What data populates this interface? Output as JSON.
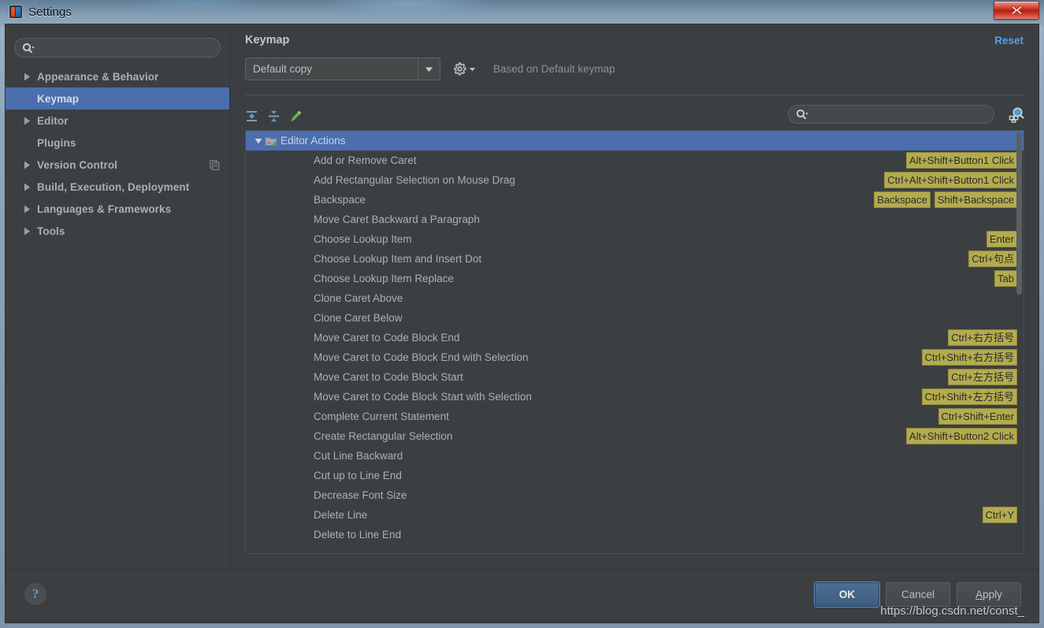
{
  "window": {
    "title": "Settings",
    "app_icon": "intellij-idea-icon",
    "close_label": "X"
  },
  "sidebar": {
    "search": {
      "placeholder": "",
      "value": "",
      "icon": "search-icon"
    },
    "items": [
      {
        "label": "Appearance & Behavior",
        "expandable": true,
        "selected": false,
        "badge": ""
      },
      {
        "label": "Keymap",
        "expandable": false,
        "selected": true,
        "badge": ""
      },
      {
        "label": "Editor",
        "expandable": true,
        "selected": false,
        "badge": ""
      },
      {
        "label": "Plugins",
        "expandable": false,
        "selected": false,
        "badge": ""
      },
      {
        "label": "Version Control",
        "expandable": true,
        "selected": false,
        "badge": "copy-icon"
      },
      {
        "label": "Build, Execution, Deployment",
        "expandable": true,
        "selected": false,
        "badge": ""
      },
      {
        "label": "Languages & Frameworks",
        "expandable": true,
        "selected": false,
        "badge": ""
      },
      {
        "label": "Tools",
        "expandable": true,
        "selected": false,
        "badge": ""
      }
    ]
  },
  "content": {
    "title": "Keymap",
    "reset_label": "Reset",
    "keymap_combo": {
      "value": "Default copy",
      "arrow_icon": "chevron-down-icon"
    },
    "gear_icon": "gear-icon",
    "based_on": "Based on Default keymap",
    "toolbar": {
      "expand_all_icon": "expand-all-icon",
      "collapse_all_icon": "collapse-all-icon",
      "edit_shortcut_icon": "pencil-edit-icon"
    },
    "tree_search": {
      "placeholder": "",
      "value": "",
      "icon": "search-icon"
    },
    "find_by_shortcut_icon": "find-by-shortcut-icon"
  },
  "tree": {
    "group": {
      "label": "Editor Actions",
      "icon": "folder-edit-icon",
      "expanded": true,
      "selected": true
    },
    "rows": [
      {
        "label": "Add or Remove Caret",
        "shortcuts": [
          "Alt+Shift+Button1 Click"
        ]
      },
      {
        "label": "Add Rectangular Selection on Mouse Drag",
        "shortcuts": [
          "Ctrl+Alt+Shift+Button1 Click"
        ]
      },
      {
        "label": "Backspace",
        "shortcuts": [
          "Backspace",
          "Shift+Backspace"
        ]
      },
      {
        "label": "Move Caret Backward a Paragraph",
        "shortcuts": []
      },
      {
        "label": "Choose Lookup Item",
        "shortcuts": [
          "Enter"
        ]
      },
      {
        "label": "Choose Lookup Item and Insert Dot",
        "shortcuts": [
          "Ctrl+句点"
        ]
      },
      {
        "label": "Choose Lookup Item Replace",
        "shortcuts": [
          "Tab"
        ]
      },
      {
        "label": "Clone Caret Above",
        "shortcuts": []
      },
      {
        "label": "Clone Caret Below",
        "shortcuts": []
      },
      {
        "label": "Move Caret to Code Block End",
        "shortcuts": [
          "Ctrl+右方括号"
        ]
      },
      {
        "label": "Move Caret to Code Block End with Selection",
        "shortcuts": [
          "Ctrl+Shift+右方括号"
        ]
      },
      {
        "label": "Move Caret to Code Block Start",
        "shortcuts": [
          "Ctrl+左方括号"
        ]
      },
      {
        "label": "Move Caret to Code Block Start with Selection",
        "shortcuts": [
          "Ctrl+Shift+左方括号"
        ]
      },
      {
        "label": "Complete Current Statement",
        "shortcuts": [
          "Ctrl+Shift+Enter"
        ]
      },
      {
        "label": "Create Rectangular Selection",
        "shortcuts": [
          "Alt+Shift+Button2 Click"
        ]
      },
      {
        "label": "Cut Line Backward",
        "shortcuts": []
      },
      {
        "label": "Cut up to Line End",
        "shortcuts": []
      },
      {
        "label": "Decrease Font Size",
        "shortcuts": []
      },
      {
        "label": "Delete Line",
        "shortcuts": [
          "Ctrl+Y"
        ]
      },
      {
        "label": "Delete to Line End",
        "shortcuts": []
      }
    ]
  },
  "footer": {
    "help_label": "?",
    "ok_label": "OK",
    "cancel_label": "Cancel",
    "apply_label": "Apply",
    "apply_mnemonic": "A",
    "apply_rest": "pply",
    "watermark": "https://blog.csdn.net/const_"
  },
  "colors": {
    "accent_selection": "#4b6eaf",
    "link": "#589df6",
    "shortcut_badge": "#b3ab4e",
    "panel_bg": "#3c3f41"
  }
}
